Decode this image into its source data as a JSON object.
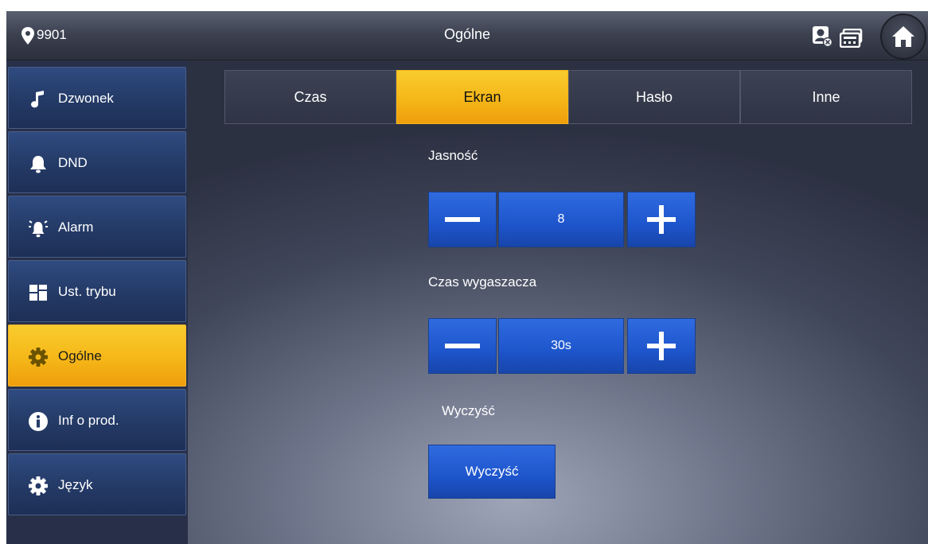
{
  "header": {
    "room_number": "9901",
    "title": "Ogólne"
  },
  "sidebar": {
    "items": [
      {
        "label": "Dzwonek",
        "icon": "music-note-icon"
      },
      {
        "label": "DND",
        "icon": "bell-icon"
      },
      {
        "label": "Alarm",
        "icon": "alarm-siren-icon"
      },
      {
        "label": "Ust. trybu",
        "icon": "grid-icon"
      },
      {
        "label": "Ogólne",
        "icon": "gear-icon",
        "active": true
      },
      {
        "label": "Inf o prod.",
        "icon": "info-icon"
      },
      {
        "label": "Język",
        "icon": "gear-icon"
      }
    ]
  },
  "tabs": [
    {
      "label": "Czas"
    },
    {
      "label": "Ekran",
      "active": true
    },
    {
      "label": "Hasło"
    },
    {
      "label": "Inne"
    }
  ],
  "brightness": {
    "label": "Jasność",
    "value": "8"
  },
  "screensaver": {
    "label": "Czas wygaszacza",
    "value": "30s"
  },
  "clear": {
    "label": "Wyczyść",
    "button_label": "Wyczyść"
  },
  "colors": {
    "active_accent": "#f5b718",
    "button_blue": "#1e55cc",
    "sidebar_blue": "#243a66"
  }
}
